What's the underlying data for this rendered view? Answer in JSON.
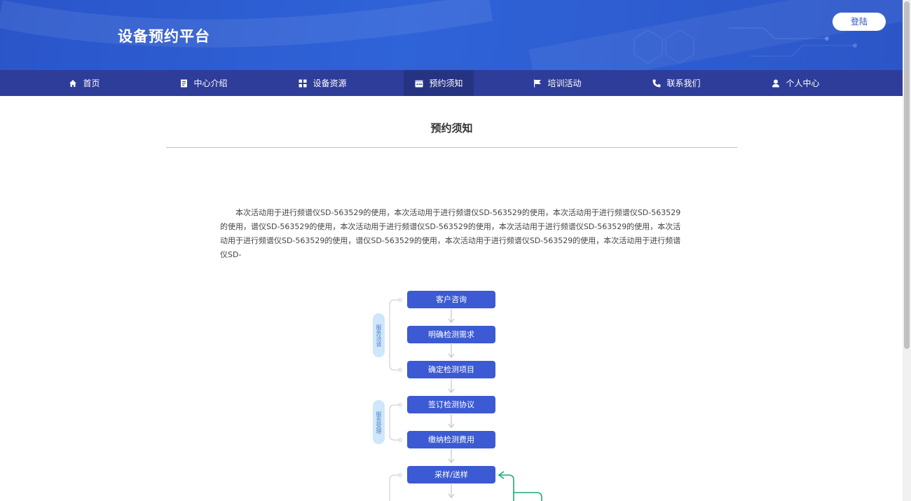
{
  "header": {
    "site_title": "设备预约平台",
    "login_label": "登陆"
  },
  "nav": {
    "items": [
      {
        "label": "首页",
        "icon": "home-icon"
      },
      {
        "label": "中心介绍",
        "icon": "document-icon"
      },
      {
        "label": "设备资源",
        "icon": "grid-icon"
      },
      {
        "label": "预约须知",
        "icon": "calendar-icon",
        "active": true
      },
      {
        "label": "培训活动",
        "icon": "flag-icon"
      },
      {
        "label": "联系我们",
        "icon": "phone-icon"
      },
      {
        "label": "个人中心",
        "icon": "user-icon"
      }
    ]
  },
  "main": {
    "title": "预约须知",
    "notice_text": "本次活动用于进行频谱仪SD-563529的使用，本次活动用于进行频谱仪SD-563529的使用，本次活动用于进行频谱仪SD-563529的使用，谱仪SD-563529的使用，本次活动用于进行频谱仪SD-563529的使用，本次活动用于进行频谱仪SD-563529的使用，本次活动用于进行频谱仪SD-563529的使用，谱仪SD-563529的使用，本次活动用于进行频谱仪SD-563529的使用，本次活动用于进行频谱仪SD-"
  },
  "flow": {
    "steps": [
      "客户咨询",
      "明确检测需求",
      "确定检测项目",
      "签订检测协议",
      "缴纳检测费用",
      "采样/送样"
    ],
    "groups": [
      "服务洽谈",
      "服务受理"
    ]
  },
  "colors": {
    "banner": "#2f63d8",
    "nav": "#2e3d9a",
    "nav_active": "#263383",
    "flow_box": "#3b5ad3",
    "group_pill": "#cfe6fb",
    "feedback_arrow": "#1aab6f"
  }
}
